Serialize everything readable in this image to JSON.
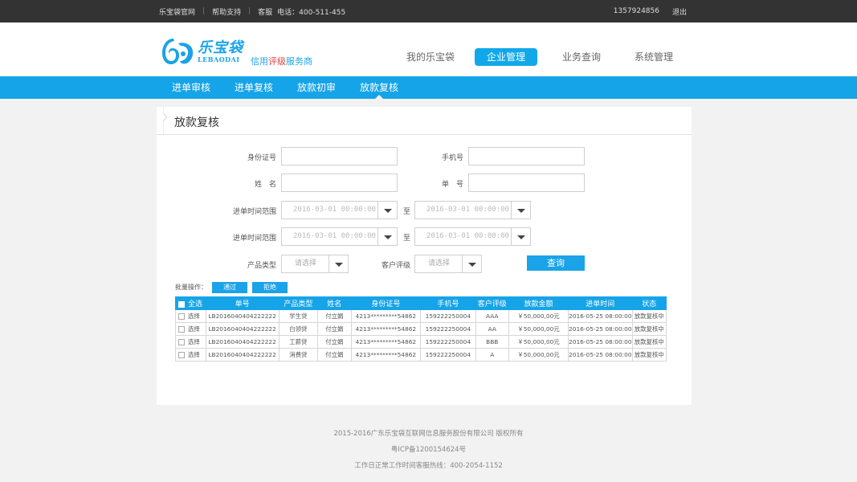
{
  "topbar": {
    "site_link": "乐宝袋官网",
    "help": "帮助支持",
    "service_label": "客服",
    "phone": "电话：400-511-455",
    "user": "1357924856",
    "logout": "退出"
  },
  "logo": {
    "cn": "乐宝袋",
    "en": "LEBAODAI",
    "slogan_a": "信用",
    "slogan_b": "评级",
    "slogan_c": "服务商"
  },
  "mainnav": [
    "我的乐宝袋",
    "企业管理",
    "业务查询",
    "系统管理"
  ],
  "subnav": [
    "进单审核",
    "进单复核",
    "放款初审",
    "放款复核"
  ],
  "panel": {
    "title": "放款复核"
  },
  "form": {
    "id_label": "身份证号",
    "phone_label": "手机号",
    "name_label": "姓　名",
    "order_label": "单　号",
    "range_label_1": "进单时间范围",
    "range_label_2": "进单时间范围",
    "to": "至",
    "date_placeholder": "2016-03-01  00:00:00",
    "product_label": "产品类型",
    "rating_label": "客户评级",
    "select_placeholder": "请选择",
    "query": "查询"
  },
  "batch": {
    "label": "批量操作：",
    "pass": "通过",
    "reject": "拒绝"
  },
  "table": {
    "headers": [
      "全选",
      "单号",
      "产品类型",
      "姓名",
      "身份证号",
      "手机号",
      "客户评级",
      "放款金额",
      "进单时间",
      "状态"
    ],
    "rows": [
      [
        "选择",
        "LB2016040404222222",
        "学生贷",
        "付立娟",
        "4213*********54862",
        "159222250004",
        "AAA",
        "￥50,000,00元",
        "2016-05-25 08:00:00",
        "放款复核中"
      ],
      [
        "选择",
        "LB2016040404222222",
        "白领贷",
        "付立娟",
        "4213*********54862",
        "159222250004",
        "AA",
        "￥50,000,00元",
        "2016-05-25 08:00:00",
        "放款复核中"
      ],
      [
        "选择",
        "LB2016040404222222",
        "工薪贷",
        "付立娟",
        "4213*********54862",
        "159222250004",
        "BBB",
        "￥50,000,00元",
        "2016-05-25 08:00:00",
        "放款复核中"
      ],
      [
        "选择",
        "LB2016040404222222",
        "消费贷",
        "付立娟",
        "4213*********54862",
        "159222250004",
        "A",
        "￥50,000,00元",
        "2016-05-25 08:00:00",
        "放款复核中"
      ]
    ]
  },
  "footer": {
    "copyright": "2015-2016广东乐宝袋互联网信息服务股份有限公司 版权所有",
    "icp": "粤ICP备1200154624号",
    "hotline": "工作日正常工作时间客服热线：400-2054-1152"
  },
  "colors": {
    "accent": "#16a4e8",
    "topbar": "#333333",
    "slogan_red": "#e63b3b"
  }
}
